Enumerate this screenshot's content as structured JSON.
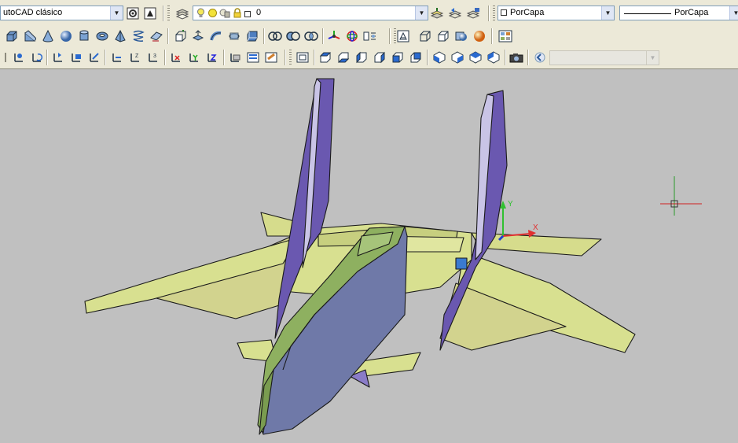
{
  "workspace_combo": {
    "value": "utoCAD clásico"
  },
  "layer_combo": {
    "value": "0",
    "state_icons": [
      "bulb-on-icon",
      "sun-icon",
      "lock-icon",
      "color-square-icon"
    ]
  },
  "color_combo": {
    "value": "PorCapa"
  },
  "linetype_combo": {
    "value": "PorCapa"
  },
  "view_combo": {
    "value": ""
  },
  "toolbars": {
    "row1_buttons": [
      "workspace-settings-icon",
      "workspace-save-icon",
      "layer-properties-icon",
      "make-object-layer-current-icon",
      "layer-previous-icon",
      "layer-states-icon"
    ],
    "modeling": [
      "box-icon",
      "wedge-icon",
      "cone-icon",
      "sphere-icon",
      "cylinder-icon",
      "torus-icon",
      "pyramid-icon",
      "helix-icon",
      "planar-surface-icon",
      "extrude-icon",
      "presspull-icon",
      "sweep-icon",
      "revolve-icon",
      "loft-icon",
      "union-icon",
      "subtract-icon",
      "intersect-icon",
      "3d-move-icon",
      "3d-rotate-icon",
      "3d-align-icon"
    ],
    "ucs": [
      "ucs-icon",
      "ucs-world-icon",
      "ucs-previous-icon",
      "ucs-face-icon",
      "ucs-object-icon",
      "ucs-view-icon",
      "ucs-origin-icon",
      "ucs-zaxis-icon",
      "ucs-3point-icon",
      "ucs-x-icon",
      "ucs-y-icon",
      "ucs-z-icon",
      "ucs-apply-icon",
      "named-ucs-icon",
      "ucs-settings-icon"
    ],
    "views": [
      "named-views-icon",
      "top-view-icon",
      "bottom-view-icon",
      "left-view-icon",
      "right-view-icon",
      "front-view-icon",
      "back-view-icon",
      "sw-iso-icon",
      "se-iso-icon",
      "ne-iso-icon",
      "nw-iso-icon",
      "camera-icon",
      "view-previous-icon"
    ]
  },
  "colors": {
    "toolbar_bg": "#ece9d8",
    "viewport_bg": "#c0c0c0",
    "fuselage": "#8eb060",
    "wing": "#d8e090",
    "fin": "#6a58b0",
    "ucs_x": "#e03030",
    "ucs_y": "#30c030",
    "ucs_z": "#2040d0"
  },
  "viewport": {
    "ucs_x_label": "X",
    "ucs_y_label": "Y"
  }
}
